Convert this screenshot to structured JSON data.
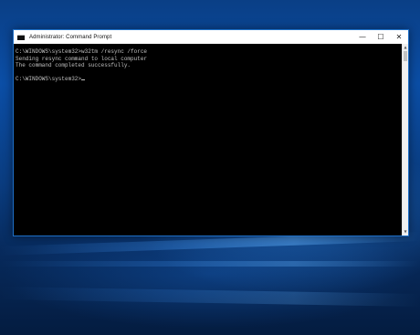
{
  "window": {
    "title": "Administrator: Command Prompt",
    "controls": {
      "minimize": "—",
      "maximize": "☐",
      "close": "✕"
    }
  },
  "console": {
    "lines": [
      "C:\\WINDOWS\\system32>w32tm /resync /force",
      "Sending resync command to local computer",
      "The command completed successfully.",
      "",
      "C:\\WINDOWS\\system32>"
    ]
  },
  "scrollbar": {
    "up": "▲",
    "down": "▼"
  },
  "icons": {
    "app": "cmd-icon"
  },
  "colors": {
    "console_bg": "#000000",
    "console_fg": "#c0c0c0",
    "window_border": "#1e6fc7",
    "desktop": "#0b4ea6"
  }
}
